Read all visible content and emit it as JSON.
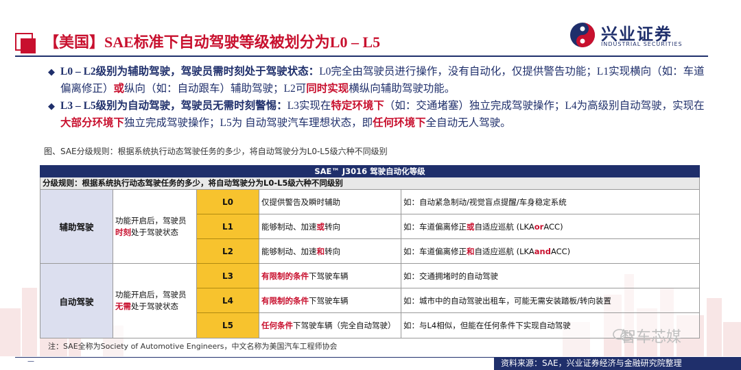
{
  "header": {
    "title": "【美国】SAE标准下自动驾驶等级被划分为L0 – L5",
    "brand_cn": "兴业证券",
    "brand_en": "INDUSTRIAL SECURITIES"
  },
  "bullets": {
    "b1": {
      "lead": "L0 – L2级别为辅助驾驶，驾驶员需时刻处于驾驶状态：",
      "t1": "L0完全由驾驶员进行操作，没有自动化，仅提供警告功能；L1实现横向（如：车道偏离修正）",
      "h1": "或",
      "t2": "纵向（如：自动跟车）辅助驾驶；L2可",
      "h2": "同时实现",
      "t3": "横纵向辅助驾驶功能。"
    },
    "b2": {
      "lead": "L3 – L5级别为自动驾驶，驾驶员无需时刻警惕：",
      "t1": "L3实现在",
      "h1": "特定环境下",
      "t2": "（如：交通堵塞）独立完成驾驶操作；L4为高级别自动驾驶，实现在",
      "h2": "大部分环境下",
      "t3": "独立完成驾驶操作；L5为 自动驾驶汽车理想状态，即",
      "h3": "任何环境下",
      "t4": "全自动无人驾驶。"
    }
  },
  "figure_caption": "图、SAE分级规则：根据系统执行动态驾驶任务的多少，将自动驾驶分为L0-L5级六种不同级别",
  "table": {
    "heading": "SAE™ J3016 驾驶自动化等级",
    "subheading": "分级规则：根据系统执行动态驾驶任务的多少，将自动驾驶分为L0-L5级六种不同级别",
    "groups": [
      {
        "name": "辅助驾驶",
        "desc_a": "功能开启后，驾驶员",
        "desc_hl": "时刻",
        "desc_b": "处于驾驶状态"
      },
      {
        "name": "自动驾驶",
        "desc_a": "功能开启后，驾驶员",
        "desc_hl": "无需",
        "desc_b": "处于驾驶状态"
      }
    ],
    "rows": [
      {
        "level": "L0",
        "fn_a": "仅提供警告及瞬时辅助",
        "fn_hl": "",
        "fn_b": "",
        "ex_a": "如：自动紧急制动/视觉盲点提醒/车身稳定系统",
        "ex_hl": "",
        "ex_b": ""
      },
      {
        "level": "L1",
        "fn_a": "能够制动、加速",
        "fn_hl": "或",
        "fn_b": "转向",
        "ex_a": "如：车道偏离修正",
        "ex_hl": "或",
        "ex_b": "自适应巡航 (LKA ",
        "ex_hl2": "or",
        "ex_c": " ACC)"
      },
      {
        "level": "L2",
        "fn_a": "能够制动、加速",
        "fn_hl": "和",
        "fn_b": "转向",
        "ex_a": "如：车道偏离修正",
        "ex_hl": "和",
        "ex_b": "自适应巡航 (LKA ",
        "ex_hl2": "and",
        "ex_c": " ACC)"
      },
      {
        "level": "L3",
        "fn_a": "",
        "fn_hl": "有限制的条件",
        "fn_b": "下驾驶车辆",
        "ex_a": "如：交通拥堵时的自动驾驶",
        "ex_hl": "",
        "ex_b": ""
      },
      {
        "level": "L4",
        "fn_a": "",
        "fn_hl": "有限制的条件",
        "fn_b": "下驾驶车辆",
        "ex_a": "如：城市中的自动驾驶出租车，可能无需安装踏板/转向装置",
        "ex_hl": "",
        "ex_b": ""
      },
      {
        "level": "L5",
        "fn_a": "",
        "fn_hl": "任何条件",
        "fn_b": "下驾驶车辆（完全自动驾驶）",
        "ex_a": "如：与L4相似，但能在任何条件下实现自动驾驶",
        "ex_hl": "",
        "ex_b": ""
      }
    ]
  },
  "note": "注：SAE全称为Society of Automotive Engineers，中文名称为美国汽车工程师协会",
  "watermark": "智车芯媒",
  "footer": {
    "page": "—",
    "source": "资料来源：SAE，兴业证券经济与金融研究院整理"
  },
  "colors": {
    "accent_red": "#c8102e",
    "navy": "#1f2f6b",
    "level_yellow": "#f7c32e",
    "group_bg": "#dcdfef"
  }
}
